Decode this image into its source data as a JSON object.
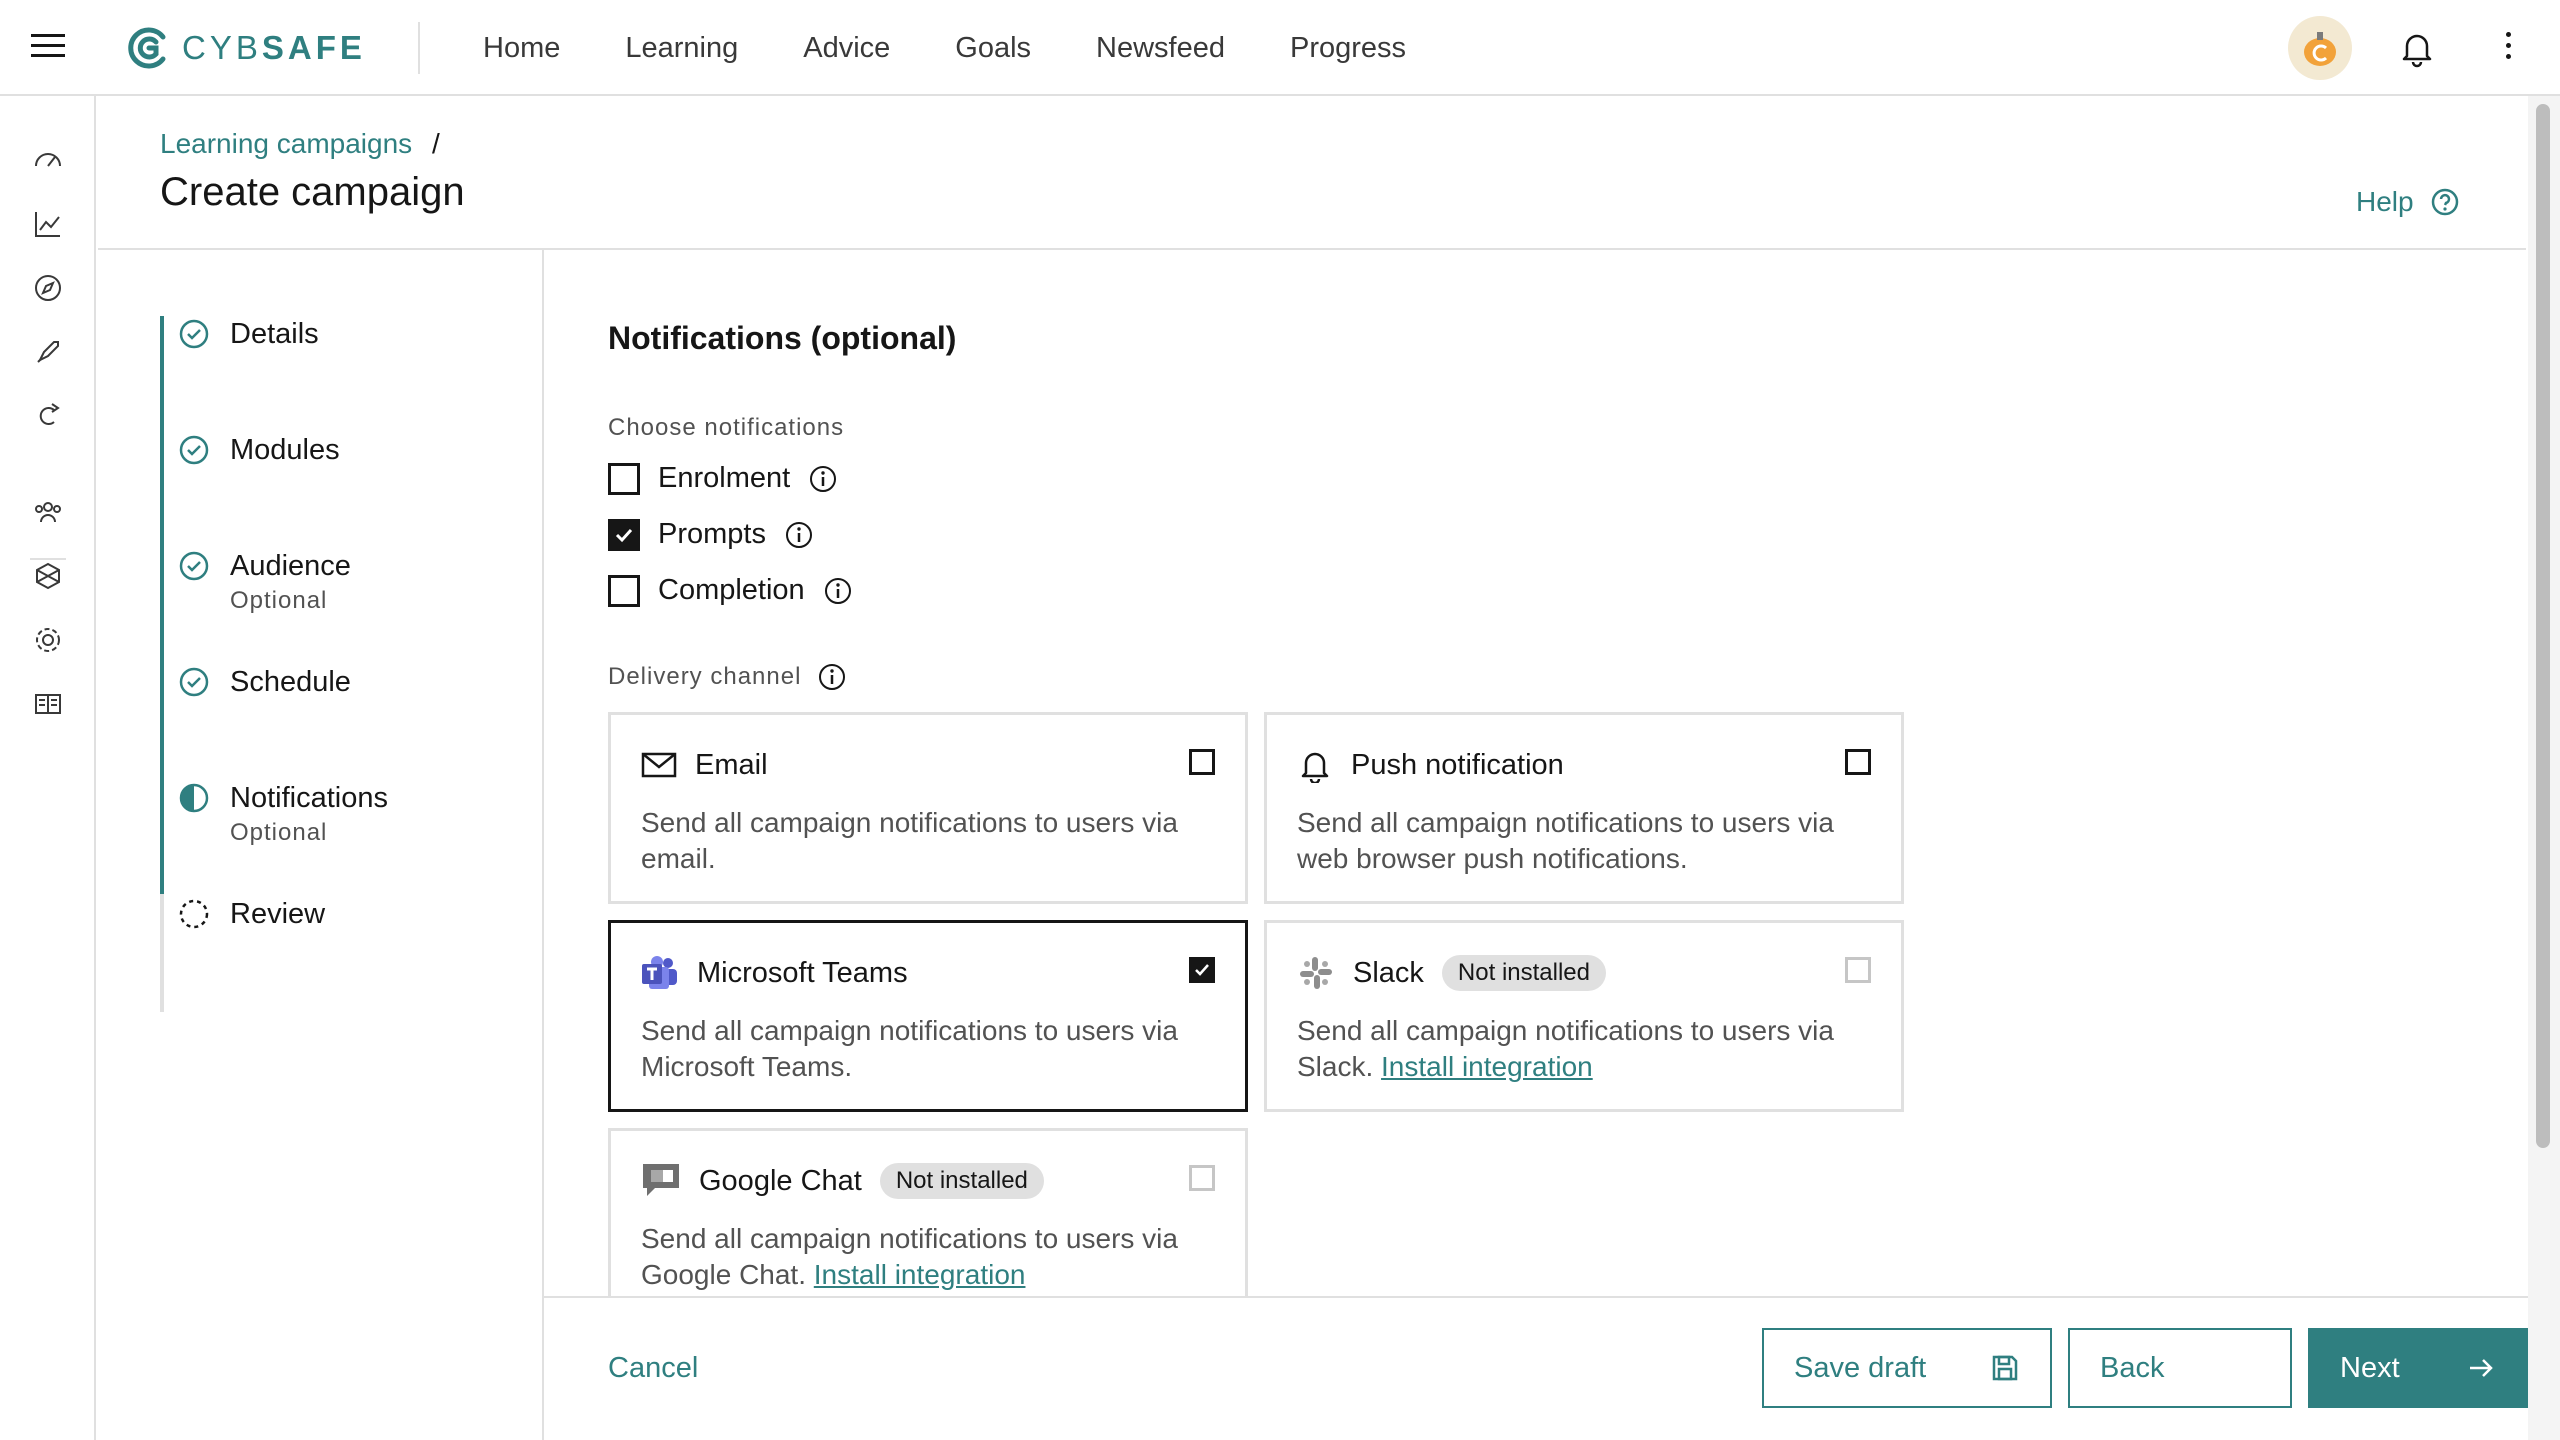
{
  "header": {
    "logo_text": "CYBSAFE",
    "nav": [
      "Home",
      "Learning",
      "Advice",
      "Goals",
      "Newsfeed",
      "Progress"
    ]
  },
  "rail_icons": [
    "dashboard-icon",
    "chart-icon",
    "compass-icon",
    "rocket-icon",
    "campaign-icon",
    "users-icon",
    "integration-icon",
    "gear-icon",
    "report-icon"
  ],
  "page": {
    "breadcrumb": "Learning campaigns",
    "breadcrumb_sep": "/",
    "title": "Create campaign",
    "help": "Help"
  },
  "steps": [
    {
      "label": "Details",
      "sub": "",
      "status": "complete"
    },
    {
      "label": "Modules",
      "sub": "",
      "status": "complete"
    },
    {
      "label": "Audience",
      "sub": "Optional",
      "status": "complete"
    },
    {
      "label": "Schedule",
      "sub": "",
      "status": "complete"
    },
    {
      "label": "Notifications",
      "sub": "Optional",
      "status": "current"
    },
    {
      "label": "Review",
      "sub": "",
      "status": "incomplete"
    }
  ],
  "notifications": {
    "title": "Notifications (optional)",
    "choose_label": "Choose notifications",
    "options": [
      {
        "label": "Enrolment",
        "checked": false
      },
      {
        "label": "Prompts",
        "checked": true
      },
      {
        "label": "Completion",
        "checked": false
      }
    ],
    "delivery_label": "Delivery channel",
    "channels": {
      "email": {
        "title": "Email",
        "desc": "Send all campaign notifications to users via email.",
        "checked": false
      },
      "push": {
        "title": "Push notification",
        "desc": "Send all campaign notifications to users via web browser push notifications.",
        "checked": false
      },
      "teams": {
        "title": "Microsoft Teams",
        "desc": "Send all campaign notifications to users via Microsoft Teams.",
        "checked": true
      },
      "slack": {
        "title": "Slack",
        "tag": "Not installed",
        "desc": "Send all campaign notifications to users via Slack.",
        "link": "Install integration",
        "checked": false
      },
      "gchat": {
        "title": "Google Chat",
        "tag": "Not installed",
        "desc": "Send all campaign notifications to users via Google Chat.",
        "link": "Install integration",
        "checked": false
      }
    }
  },
  "footer": {
    "cancel": "Cancel",
    "save_draft": "Save draft",
    "back": "Back",
    "next": "Next"
  },
  "colors": {
    "accent": "#2f7f80",
    "text": "#161616",
    "muted": "#525252",
    "border": "#e0e0e0"
  }
}
